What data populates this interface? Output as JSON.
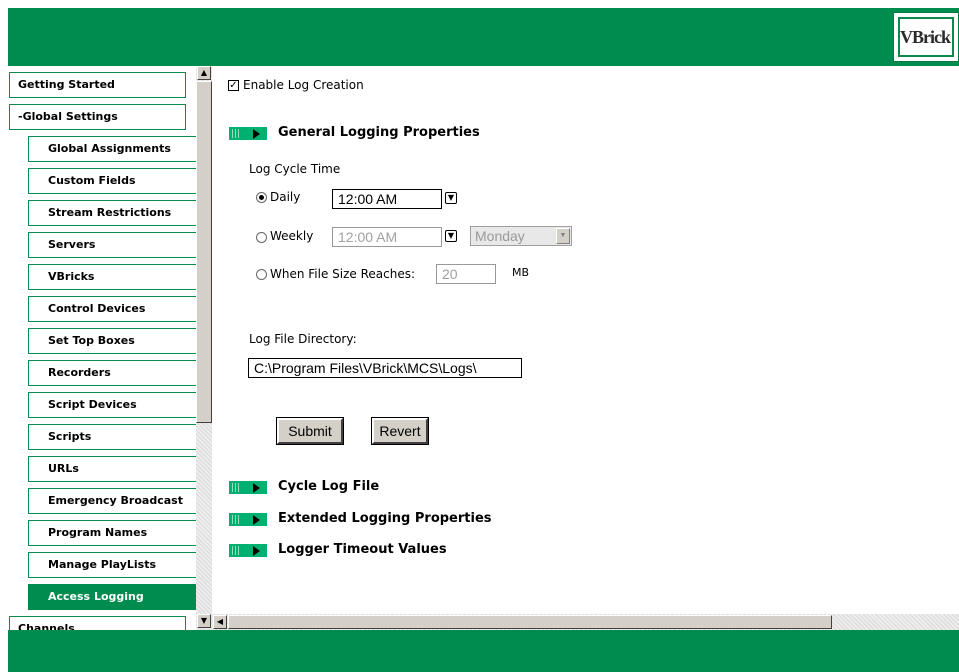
{
  "header": {
    "logo_text": "VBrick"
  },
  "sidebar": {
    "items": [
      {
        "label": "Getting Started",
        "level": "top",
        "active": false
      },
      {
        "label": "-Global Settings",
        "level": "top",
        "active": false
      },
      {
        "label": "Global Assignments",
        "level": "sub",
        "active": false
      },
      {
        "label": "Custom Fields",
        "level": "sub",
        "active": false
      },
      {
        "label": "Stream Restrictions",
        "level": "sub",
        "active": false
      },
      {
        "label": "Servers",
        "level": "sub",
        "active": false
      },
      {
        "label": "VBricks",
        "level": "sub",
        "active": false
      },
      {
        "label": "Control Devices",
        "level": "sub",
        "active": false
      },
      {
        "label": "Set Top Boxes",
        "level": "sub",
        "active": false
      },
      {
        "label": "Recorders",
        "level": "sub",
        "active": false
      },
      {
        "label": "Script Devices",
        "level": "sub",
        "active": false
      },
      {
        "label": "Scripts",
        "level": "sub",
        "active": false
      },
      {
        "label": "URLs",
        "level": "sub",
        "active": false
      },
      {
        "label": "Emergency Broadcast",
        "level": "sub",
        "active": false
      },
      {
        "label": "Program Names",
        "level": "sub",
        "active": false
      },
      {
        "label": "Manage PlayLists",
        "level": "sub",
        "active": false
      },
      {
        "label": "Access Logging",
        "level": "sub",
        "active": true
      },
      {
        "label": "Channels",
        "level": "top",
        "active": false
      }
    ]
  },
  "main": {
    "enable_log_creation": {
      "label": "Enable Log Creation",
      "checked": true
    },
    "general": {
      "title": "General Logging Properties",
      "cycle_time_label": "Log Cycle Time",
      "daily": {
        "label": "Daily",
        "selected": true,
        "time": "12:00 AM"
      },
      "weekly": {
        "label": "Weekly",
        "selected": false,
        "time": "12:00 AM",
        "day": "Monday"
      },
      "filesize": {
        "label": "When File Size Reaches:",
        "selected": false,
        "value": "20",
        "unit": "MB"
      },
      "directory_label": "Log File Directory:",
      "directory_value": "C:\\Program Files\\VBrick\\MCS\\Logs\\",
      "submit_label": "Submit",
      "revert_label": "Revert"
    },
    "sections": [
      {
        "title": "Cycle Log File"
      },
      {
        "title": "Extended Logging Properties"
      },
      {
        "title": "Logger Timeout Values"
      }
    ]
  },
  "colors": {
    "brand_green": "#008b4f",
    "accent_green": "#00b070"
  },
  "icons": {
    "expand": "play-arrow-icon",
    "spinner": "down-arrow-icon",
    "dropdown": "chevron-down-icon"
  }
}
